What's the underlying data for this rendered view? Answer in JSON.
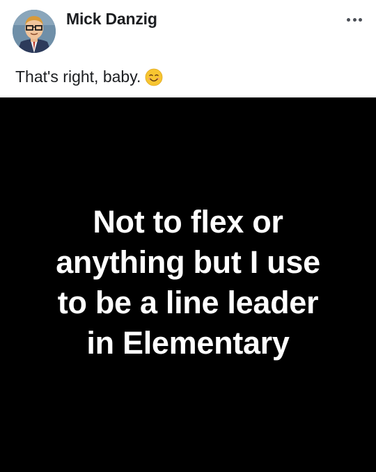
{
  "post": {
    "author": {
      "name": "Mick Danzig",
      "avatar_icon": "cartoon-man-avatar"
    },
    "more_icon": "more-options-icon",
    "caption": {
      "text": "That's right, baby.",
      "emoji_icon": "smiling-face-emoji"
    },
    "image": {
      "background": "#000000",
      "text_color": "#ffffff",
      "lines": [
        "Not to flex or",
        "anything but I use",
        "to be a line leader",
        "in Elementary"
      ]
    }
  }
}
